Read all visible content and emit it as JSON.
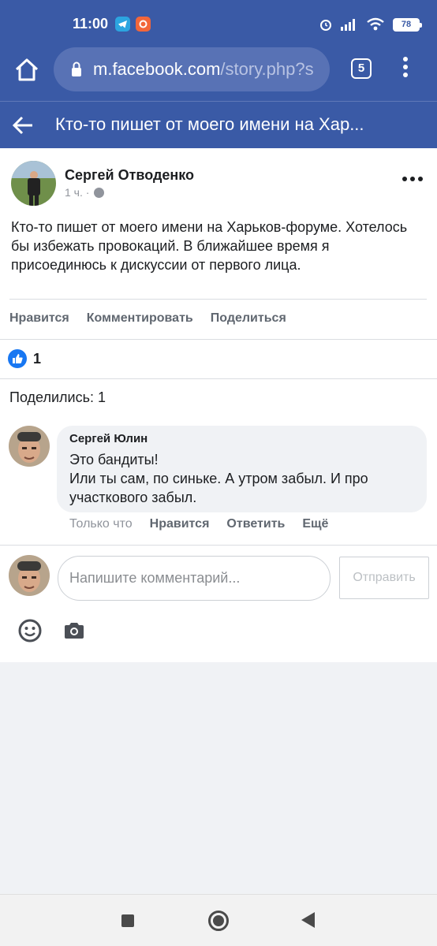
{
  "status_bar": {
    "time": "11:00",
    "battery": "78",
    "icons": [
      "telegram-icon",
      "music-app-icon",
      "alarm-icon",
      "signal-icon",
      "wifi-icon",
      "battery-icon"
    ],
    "colors": {
      "telegram": "#2ca5e0",
      "music": "#f2663a"
    }
  },
  "browser": {
    "url_host": "m.facebook.com",
    "url_path": "/story.php?s",
    "tab_count": "5"
  },
  "header": {
    "title": "Кто-то пишет от моего имени на Хар..."
  },
  "post": {
    "author": "Сергей Отводенко",
    "time": "1 ч. ·",
    "text": "Кто-то пишет от моего имени на Харьков-форуме. Хотелось бы избежать провокаций. В ближайшее время я присоединюсь к дискуссии от первого лица.",
    "actions": {
      "like": "Нравится",
      "comment": "Комментировать",
      "share": "Поделиться"
    },
    "like_count": "1",
    "shares": "Поделились: 1"
  },
  "comment": {
    "author": "Сергей Юлин",
    "text": "Это бандиты!\nИли ты сам, по синьке. А утром забыл. И про участкового забыл.",
    "time": "Только что",
    "like": "Нравится",
    "reply": "Ответить",
    "more": "Ещё"
  },
  "composer": {
    "placeholder": "Напишите комментарий...",
    "send": "Отправить"
  },
  "theme": {
    "brand": "#3a5aa6",
    "like_blue": "#1877f2"
  }
}
